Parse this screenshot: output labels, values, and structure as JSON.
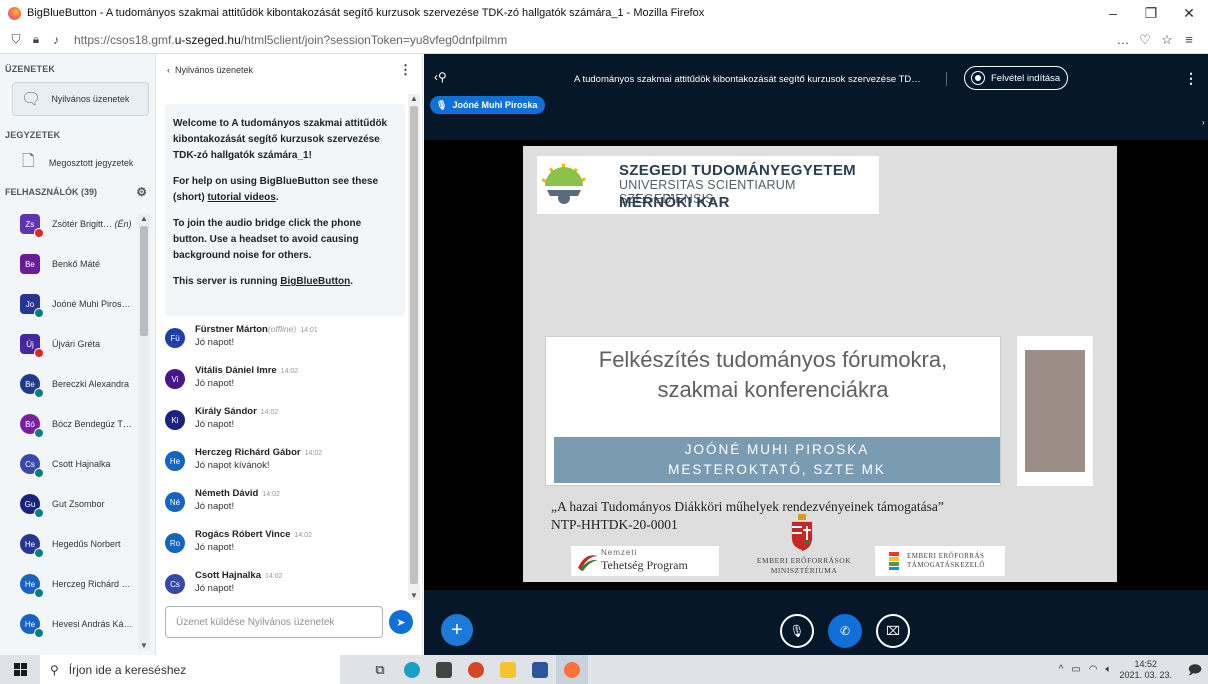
{
  "window": {
    "title": "BigBlueButton - A tudományos szakmai attitűdök kibontakozását segítő kurzusok szervezése TDK-zó hallgatók számára_1 - Mozilla Firefox",
    "minimize": "–",
    "maximize": "❐",
    "close": "✕"
  },
  "urlbar": {
    "url_prefix": "https://csos18.gmf.",
    "url_domain": "u-szeged.hu",
    "url_suffix": "/html5client/join?sessionToken=yu8vfeg0dnfpilmm"
  },
  "left": {
    "messages_title": "ÜZENETEK",
    "public_chat": "Nyilvános üzenetek",
    "notes_title": "JEGYZETEK",
    "shared_notes": "Megosztott jegyzetek",
    "users_title": "FELHASZNÁLÓK (39)",
    "users": [
      {
        "initials": "Zs",
        "name": "Zsötér Brigitt… ",
        "me": "(Én)",
        "color": "#5e35b1",
        "shape": "square",
        "status": "red"
      },
      {
        "initials": "Be",
        "name": "Benkő Máté",
        "color": "#6a1b9a",
        "shape": "square",
        "status": ""
      },
      {
        "initials": "Jo",
        "name": "Joóné Muhi Piros…",
        "color": "#283593",
        "shape": "square",
        "status": "green"
      },
      {
        "initials": "Új",
        "name": "Újvári Gréta",
        "color": "#4527a0",
        "shape": "square",
        "status": "red"
      },
      {
        "initials": "Be",
        "name": "Bereczki Alexandra",
        "color": "#1e3a8a",
        "shape": "round",
        "status": "green"
      },
      {
        "initials": "Bó",
        "name": "Bócz Bendegúz T…",
        "color": "#7b1fa2",
        "shape": "round",
        "status": "green"
      },
      {
        "initials": "Cs",
        "name": "Csott Hajnalka",
        "color": "#3949ab",
        "shape": "round",
        "status": "green"
      },
      {
        "initials": "Gu",
        "name": "Gut Zsombor",
        "color": "#1a237e",
        "shape": "round",
        "status": "green"
      },
      {
        "initials": "He",
        "name": "Hegedűs Norbert",
        "color": "#283593",
        "shape": "round",
        "status": "green"
      },
      {
        "initials": "He",
        "name": "Herczeg Richárd …",
        "color": "#1565c0",
        "shape": "round",
        "status": "green"
      },
      {
        "initials": "He",
        "name": "Hevesi András Ká…",
        "color": "#1565c0",
        "shape": "round",
        "status": "green"
      }
    ]
  },
  "chat": {
    "back_label": "Nyilvános üzenetek",
    "welcome_1": "Welcome to A tudományos szakmai attitűdök kibontakozását segítő kurzusok szervezése TDK-zó hallgatók számára_1!",
    "welcome_2a": "For help on using BigBlueButton see these (short) ",
    "welcome_2b": "tutorial videos",
    "welcome_2c": ".",
    "welcome_3": "To join the audio bridge click the phone button. Use a headset to avoid causing background noise for others.",
    "welcome_4a": "This server is running ",
    "welcome_4b": "BigBlueButton",
    "welcome_4c": ".",
    "messages": [
      {
        "initials": "Fü",
        "name": "Fürstner Márton",
        "note": "(offline)",
        "time": "14:01",
        "text": "Jó napot!",
        "color": "#1e40af"
      },
      {
        "initials": "Vi",
        "name": "Vitális Dániel Imre",
        "note": "",
        "time": "14:02",
        "text": "Jó napot!",
        "color": "#4a148c"
      },
      {
        "initials": "Ki",
        "name": "Király Sándor",
        "note": "",
        "time": "14:02",
        "text": "Jó napot!",
        "color": "#1a237e"
      },
      {
        "initials": "He",
        "name": "Herczeg Richárd Gábor",
        "note": "",
        "time": "14:02",
        "text": "Jó napot kívánok!",
        "color": "#1565c0"
      },
      {
        "initials": "Né",
        "name": "Németh Dávid",
        "note": "",
        "time": "14:02",
        "text": "Jó napot!",
        "color": "#1565c0"
      },
      {
        "initials": "Ro",
        "name": "Rogács Róbert Vince",
        "note": "",
        "time": "14:02",
        "text": "Jó napot!",
        "color": "#1565c0"
      },
      {
        "initials": "Cs",
        "name": "Csott Hajnalka",
        "note": "",
        "time": "14:02",
        "text": "Jó napot!",
        "color": "#3949ab"
      }
    ],
    "input_placeholder": "Üzenet küldése Nyilvános üzenetek"
  },
  "main": {
    "meeting_title": "A tudományos szakmai attitűdök kibontakozását segítő kurzusok szervezése TD…",
    "record_label": "Felvétel indítása",
    "talker": "Joóné Muhi Piroska"
  },
  "slide": {
    "univ_line1": "SZEGEDI TUDOMÁNYEGYETEM",
    "univ_line2": "UNIVERSITAS SCIENTIARUM SZEGEDIENSIS",
    "univ_line3": "MÉRNÖKI KAR",
    "title_line1": "Felkészítés tudományos fórumokra,",
    "title_line2": "szakmai konferenciákra",
    "presenter_name": "JOÓNÉ MUHI PIROSKA",
    "presenter_role": "MESTEROKTATÓ, SZTE MK",
    "support_line1": "„A hazai Tudományos Diákköri műhelyek rendezvényeinek támogatása”",
    "support_line2": "NTP-HHTDK-20-0001",
    "logo1_a": "Nemzeti",
    "logo1_b": "Tehetség Program",
    "logo2_a": "EMBERI ERŐFORRÁSOK",
    "logo2_b": "MINISZTÉRIUMA",
    "logo3_a": "EMBERI ERŐFORRÁS",
    "logo3_b": "TÁMOGATÁSKEZELŐ"
  },
  "taskbar": {
    "search_placeholder": "Írjon ide a kereséshez",
    "time": "14:52",
    "date": "2021. 03. 23."
  }
}
